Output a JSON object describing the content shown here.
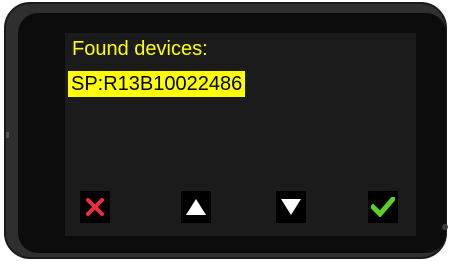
{
  "screen": {
    "title": "Found devices:",
    "devices": [
      {
        "label": "SP:R13B10022486",
        "selected": true
      }
    ]
  },
  "buttons": {
    "cancel": {
      "icon": "close-icon",
      "color": "#e8303a"
    },
    "up": {
      "icon": "arrow-up-icon",
      "color": "#ffffff"
    },
    "down": {
      "icon": "arrow-down-icon",
      "color": "#ffffff"
    },
    "confirm": {
      "icon": "checkmark-icon",
      "color": "#5bd02a"
    }
  },
  "colors": {
    "highlight": "#ffff00",
    "text": "#ffff00",
    "screen_bg": "#1b1b1b"
  }
}
